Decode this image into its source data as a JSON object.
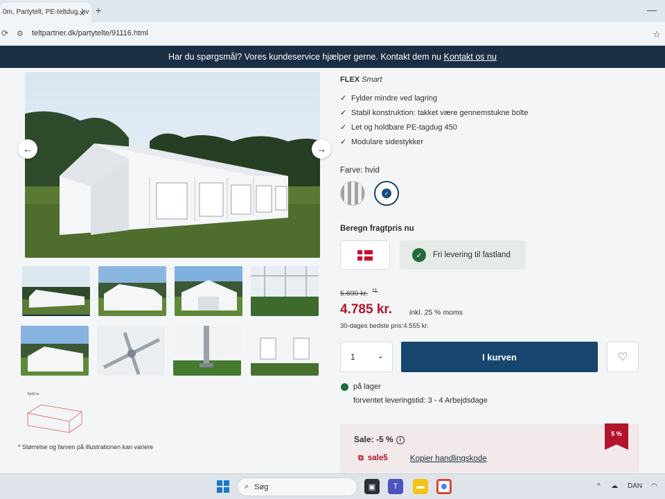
{
  "browser": {
    "tab_title": "0m, Partytelt, PE-teltdug, hv",
    "tab_close": "✕",
    "new_tab": "+",
    "url": "teltpartner.dk/partytelte/91116.html"
  },
  "banner": {
    "text": "Har du spørgsmål? Vores kundeservice hjælper gerne. Kontakt dem nu",
    "link": "Kontakt os nu"
  },
  "gallery": {
    "diagram_label": "5x10 m",
    "note": "* Størrelse og farven på illustrationen kan variere"
  },
  "product": {
    "brand_bold": "FLEX",
    "brand_italic": "Smart",
    "features": [
      "Fylder mindre ved lagring",
      "Stabil konstruktion: takket være gennemstukne bolte",
      "Let og holdbare PE-tagdug 450",
      "Modulare sidestykker"
    ],
    "color_label": "Farve: hvid",
    "freight_title": "Beregn fragtpris nu",
    "delivery_text": "Fri levering til fastland",
    "old_price": "5.690 kr.",
    "old_price_note": "*1",
    "price": "4.785 kr.",
    "vat": "inkl. 25 % moms",
    "best_price": "30-dages bedste pris:4.555 kr.",
    "quantity": "1",
    "cart_label": "I kurven",
    "stock": "på lager",
    "lead_time": "forventet leveringstid: 3 - 4 Arbejdsdage",
    "sale_label": "Sale: -5 %",
    "sale_code": "sale5",
    "copy_code": "Kopier handlingskode",
    "sale_tag": "5 %"
  },
  "taskbar": {
    "search_label": "Søg",
    "language": "DAN"
  },
  "colors": {
    "navy": "#1a2e44",
    "cart_blue": "#16466e",
    "price_red": "#b3142d",
    "stock_green": "#1f6b3a"
  }
}
